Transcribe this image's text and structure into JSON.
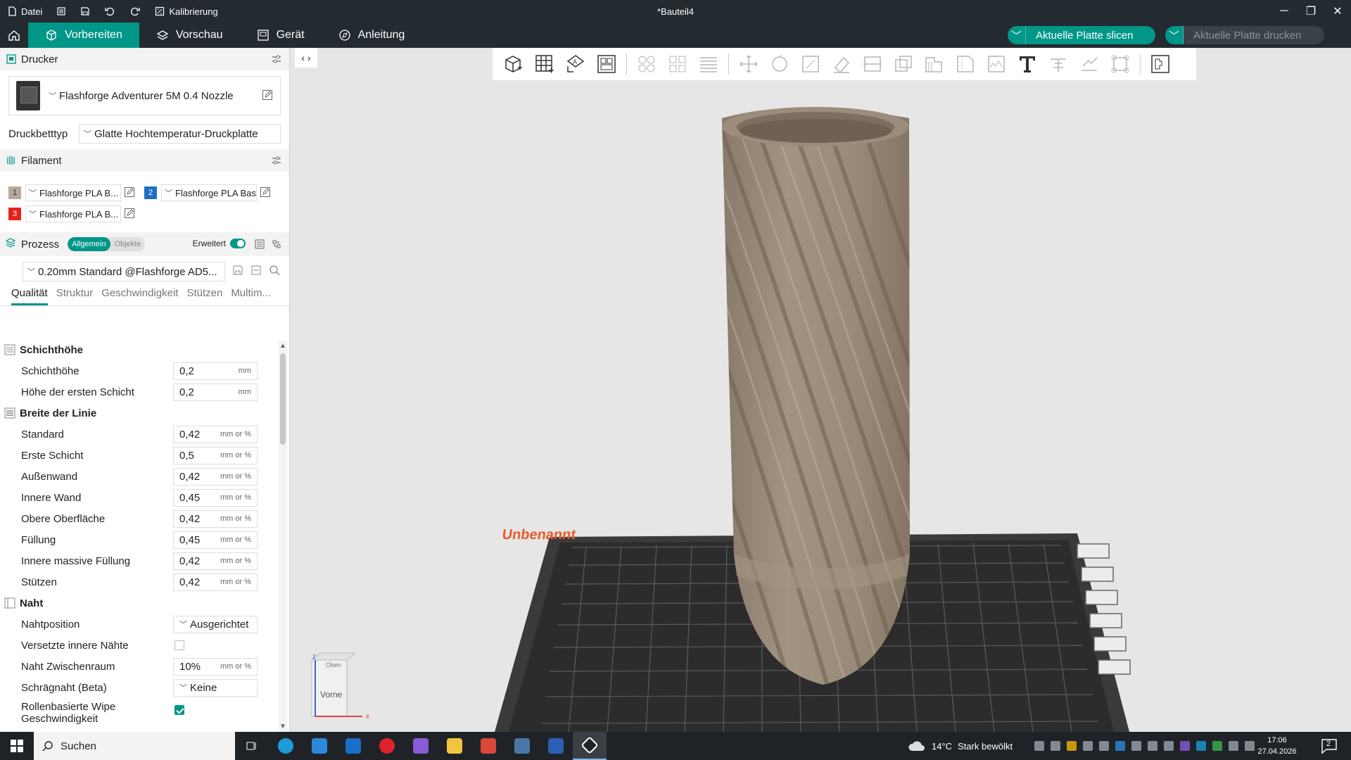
{
  "titlebar": {
    "file_label": "Datei",
    "calibration_label": "Kalibrierung",
    "window_title": "*Bauteil4"
  },
  "tabs": [
    {
      "label": "Vorbereiten"
    },
    {
      "label": "Vorschau"
    },
    {
      "label": "Gerät"
    },
    {
      "label": "Anleitung"
    }
  ],
  "actions": {
    "slice_label": "Aktuelle Platte slicen",
    "print_label": "Aktuelle Platte drucken"
  },
  "printer": {
    "section_title": "Drucker",
    "name": "Flashforge Adventurer 5M 0.4 Nozzle",
    "bed_label": "Druckbetttyp",
    "bed_value": "Glatte Hochtemperatur-Druckplatte"
  },
  "filament": {
    "section_title": "Filament",
    "items": [
      {
        "num": "1",
        "name": "Flashforge PLA B...",
        "color": "#b8a89a"
      },
      {
        "num": "2",
        "name": "Flashforge PLA Basic",
        "color": "#1e6fc4"
      },
      {
        "num": "3",
        "name": "Flashforge PLA B...",
        "color": "#e8201c"
      }
    ]
  },
  "process": {
    "section_title": "Prozess",
    "seg_global": "Allgemein",
    "seg_objects": "Objekte",
    "advanced_label": "Erweitert",
    "preset": "0.20mm Standard @Flashforge AD5...",
    "subtabs": [
      "Qualität",
      "Struktur",
      "Geschwindigkeit",
      "Stützen",
      "Multim..."
    ]
  },
  "settings": {
    "g1": "Schichthöhe",
    "r1": {
      "label": "Schichthöhe",
      "value": "0,2",
      "unit": "mm"
    },
    "r2": {
      "label": "Höhe der ersten Schicht",
      "value": "0,2",
      "unit": "mm"
    },
    "g2": "Breite der Linie",
    "r3": {
      "label": "Standard",
      "value": "0,42",
      "unit": "mm or %"
    },
    "r4": {
      "label": "Erste Schicht",
      "value": "0,5",
      "unit": "mm or %"
    },
    "r5": {
      "label": "Außenwand",
      "value": "0,42",
      "unit": "mm or %"
    },
    "r6": {
      "label": "Innere Wand",
      "value": "0,45",
      "unit": "mm or %"
    },
    "r7": {
      "label": "Obere Oberfläche",
      "value": "0,42",
      "unit": "mm or %"
    },
    "r8": {
      "label": "Füllung",
      "value": "0,45",
      "unit": "mm or %"
    },
    "r9": {
      "label": "Innere massive Füllung",
      "value": "0,42",
      "unit": "mm or %"
    },
    "r10": {
      "label": "Stützen",
      "value": "0,42",
      "unit": "mm or %"
    },
    "g3": "Naht",
    "r11": {
      "label": "Nahtposition",
      "value": "Ausgerichtet"
    },
    "r12": {
      "label": "Versetzte innere Nähte"
    },
    "r13": {
      "label": "Naht Zwischenraum",
      "value": "10%",
      "unit": "mm or %"
    },
    "r14": {
      "label": "Schrägnaht (Beta)",
      "value": "Keine"
    },
    "r15": {
      "label": "Rollenbasierte Wipe Geschwindigkeit"
    }
  },
  "viewport": {
    "plate_name": "Unbenannt",
    "view_cube_top": "Oben",
    "view_cube_front": "Vorne",
    "axis_x": "x",
    "axis_z": "z"
  },
  "taskbar": {
    "search_label": "Suchen",
    "weather_temp": "14°C",
    "weather_desc": "Stark bewölkt",
    "time": "17:06",
    "date": "27.04.2026",
    "notif_count": "2"
  }
}
